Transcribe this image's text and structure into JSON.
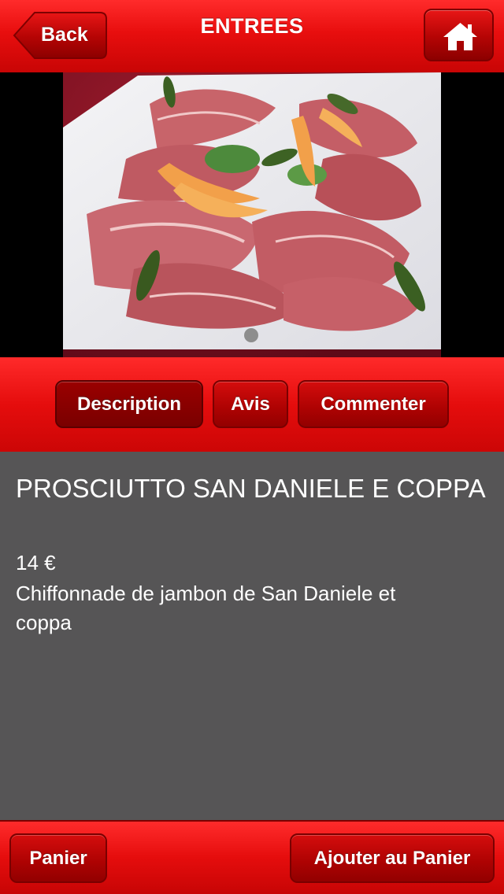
{
  "header": {
    "title": "ENTREES",
    "back_label": "Back",
    "home_icon": "home-icon"
  },
  "gallery": {
    "page_count": 1,
    "current_page": 1
  },
  "tabs": [
    {
      "label": "Description",
      "active": true
    },
    {
      "label": "Avis",
      "active": false
    },
    {
      "label": "Commenter",
      "active": false
    }
  ],
  "item": {
    "name": "PROSCIUTTO SAN DANIELE E COPPA",
    "price": "14 €",
    "description": "Chiffonnade de jambon de San Daniele et coppa"
  },
  "footer": {
    "cart_label": "Panier",
    "add_to_cart_label": "Ajouter au Panier"
  },
  "colors": {
    "brand_red": "#e80e0e",
    "button_dark_red": "#ad0202",
    "content_bg": "#565556"
  }
}
